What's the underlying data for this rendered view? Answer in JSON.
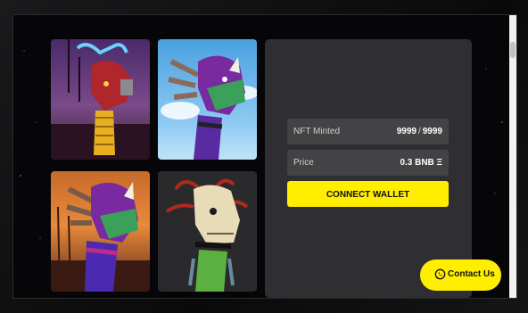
{
  "nfts": [
    {
      "name": "robot-dragon-nft",
      "bg": "#4a2a6a"
    },
    {
      "name": "purple-dragon-nft",
      "bg": "#4aa0e0"
    },
    {
      "name": "sunset-dragon-nft",
      "bg": "#c86a2a"
    },
    {
      "name": "skull-dragon-nft",
      "bg": "#2a2a2c"
    }
  ],
  "mint": {
    "minted_label": "NFT Minted",
    "minted_count": "9999",
    "minted_total": "9999",
    "price_label": "Price",
    "price_value": "0.3 BNB Ξ",
    "connect_label": "CONNECT WALLET"
  },
  "contact": {
    "label": "Contact Us"
  },
  "colors": {
    "accent": "#ffee00",
    "panel": "#2f2f31",
    "row": "#434345"
  }
}
